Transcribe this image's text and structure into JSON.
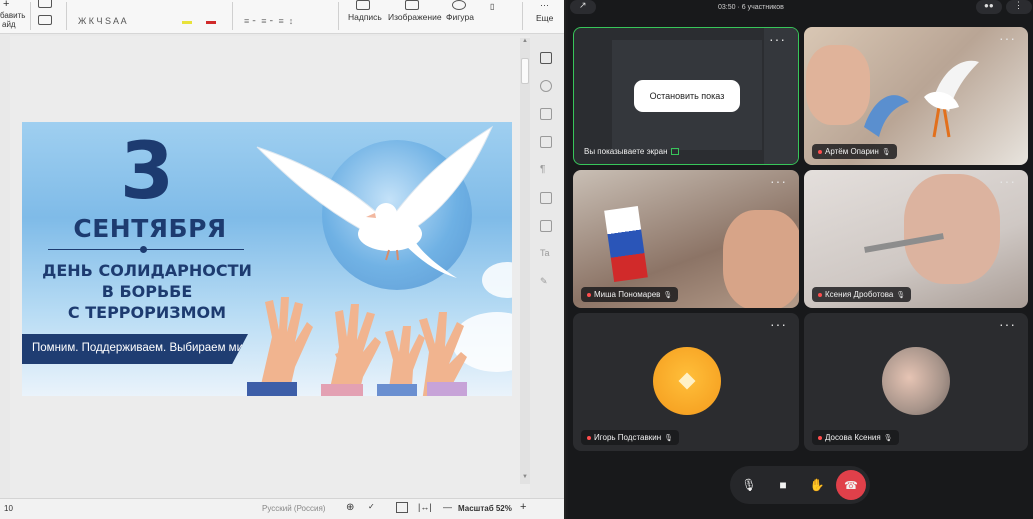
{
  "editor": {
    "ribbon": {
      "add_slide_label_line1": "бавить",
      "add_slide_label_line2": "айд",
      "format_glyphs": "Ж  К  Ч  S  A  A",
      "inscription_label": "Надпись",
      "image_label": "Изображение",
      "shape_label": "Фигура",
      "more_label": "Еще"
    },
    "slide": {
      "big_number": "3",
      "month": "СЕНТЯБРЯ",
      "headline": "ДЕНЬ СОЛИДАРНОСТИ\nВ БОРЬБЕ\nС ТЕРРОРИЗМОМ",
      "banner": "Помним. Поддерживаем. Выбираем мир."
    },
    "status_bar": {
      "slide_number": "10",
      "language": "Русский (Россия)",
      "zoom_label": "Масштаб 52%",
      "zoom_minus": "—",
      "zoom_plus": "+"
    }
  },
  "conference": {
    "header": "03:50 · 6 участников",
    "tiles": [
      {
        "name": "Вы показываете экран",
        "stop_share": "Остановить показ"
      },
      {
        "name": "Артём Опарин"
      },
      {
        "name": "Миша Пономарев"
      },
      {
        "name": "Ксения Дроботова"
      },
      {
        "name": "Игорь Подставкин"
      },
      {
        "name": "Досова Ксения"
      }
    ],
    "colors": {
      "active_border": "#38c55a",
      "end_call": "#e0404a",
      "avatar_orange": "#f6a623"
    }
  }
}
